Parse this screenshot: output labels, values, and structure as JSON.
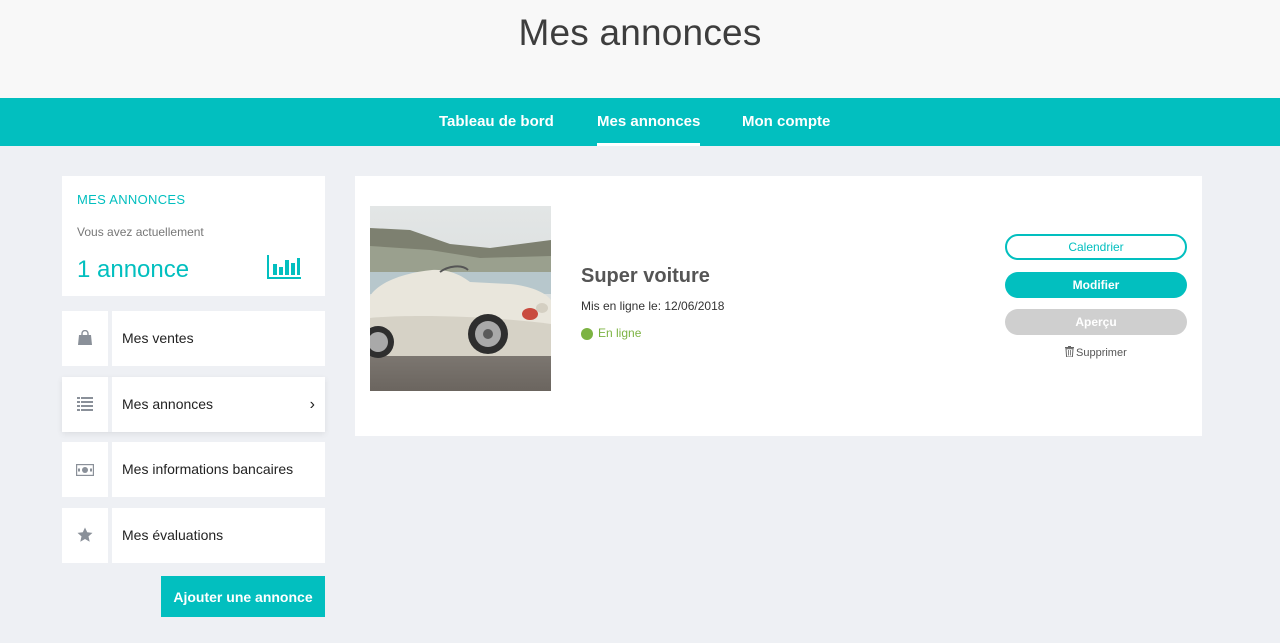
{
  "page": {
    "title": "Mes annonces"
  },
  "nav": {
    "tabs": [
      {
        "label": "Tableau de bord",
        "active": false
      },
      {
        "label": "Mes annonces",
        "active": true
      },
      {
        "label": "Mon compte",
        "active": false
      }
    ]
  },
  "summary": {
    "heading": "MES ANNONCES",
    "subtitle": "Vous avez actuellement",
    "count": "1 annonce",
    "icon": "bar-chart-icon"
  },
  "menu": {
    "items": [
      {
        "label": "Mes ventes",
        "icon": "shopping-bag-icon",
        "active": false
      },
      {
        "label": "Mes annonces",
        "icon": "list-icon",
        "active": true,
        "chevron": "›"
      },
      {
        "label": "Mes informations bancaires",
        "icon": "banknote-icon",
        "active": false
      },
      {
        "label": "Mes évaluations",
        "icon": "star-icon",
        "active": false
      }
    ]
  },
  "add_button": {
    "label": "Ajouter une annonce"
  },
  "listing": {
    "title": "Super voiture",
    "date": "Mis en ligne le: 12/06/2018",
    "status": "En ligne",
    "image": "car-photo",
    "buttons": {
      "calendar": "Calendrier",
      "edit": "Modifier",
      "preview": "Aperçu",
      "delete": "Supprimer"
    }
  },
  "colors": {
    "accent": "#02bfbf",
    "status_online": "#7cb342",
    "disabled": "#cfcfcf",
    "background": "#eef0f4"
  }
}
